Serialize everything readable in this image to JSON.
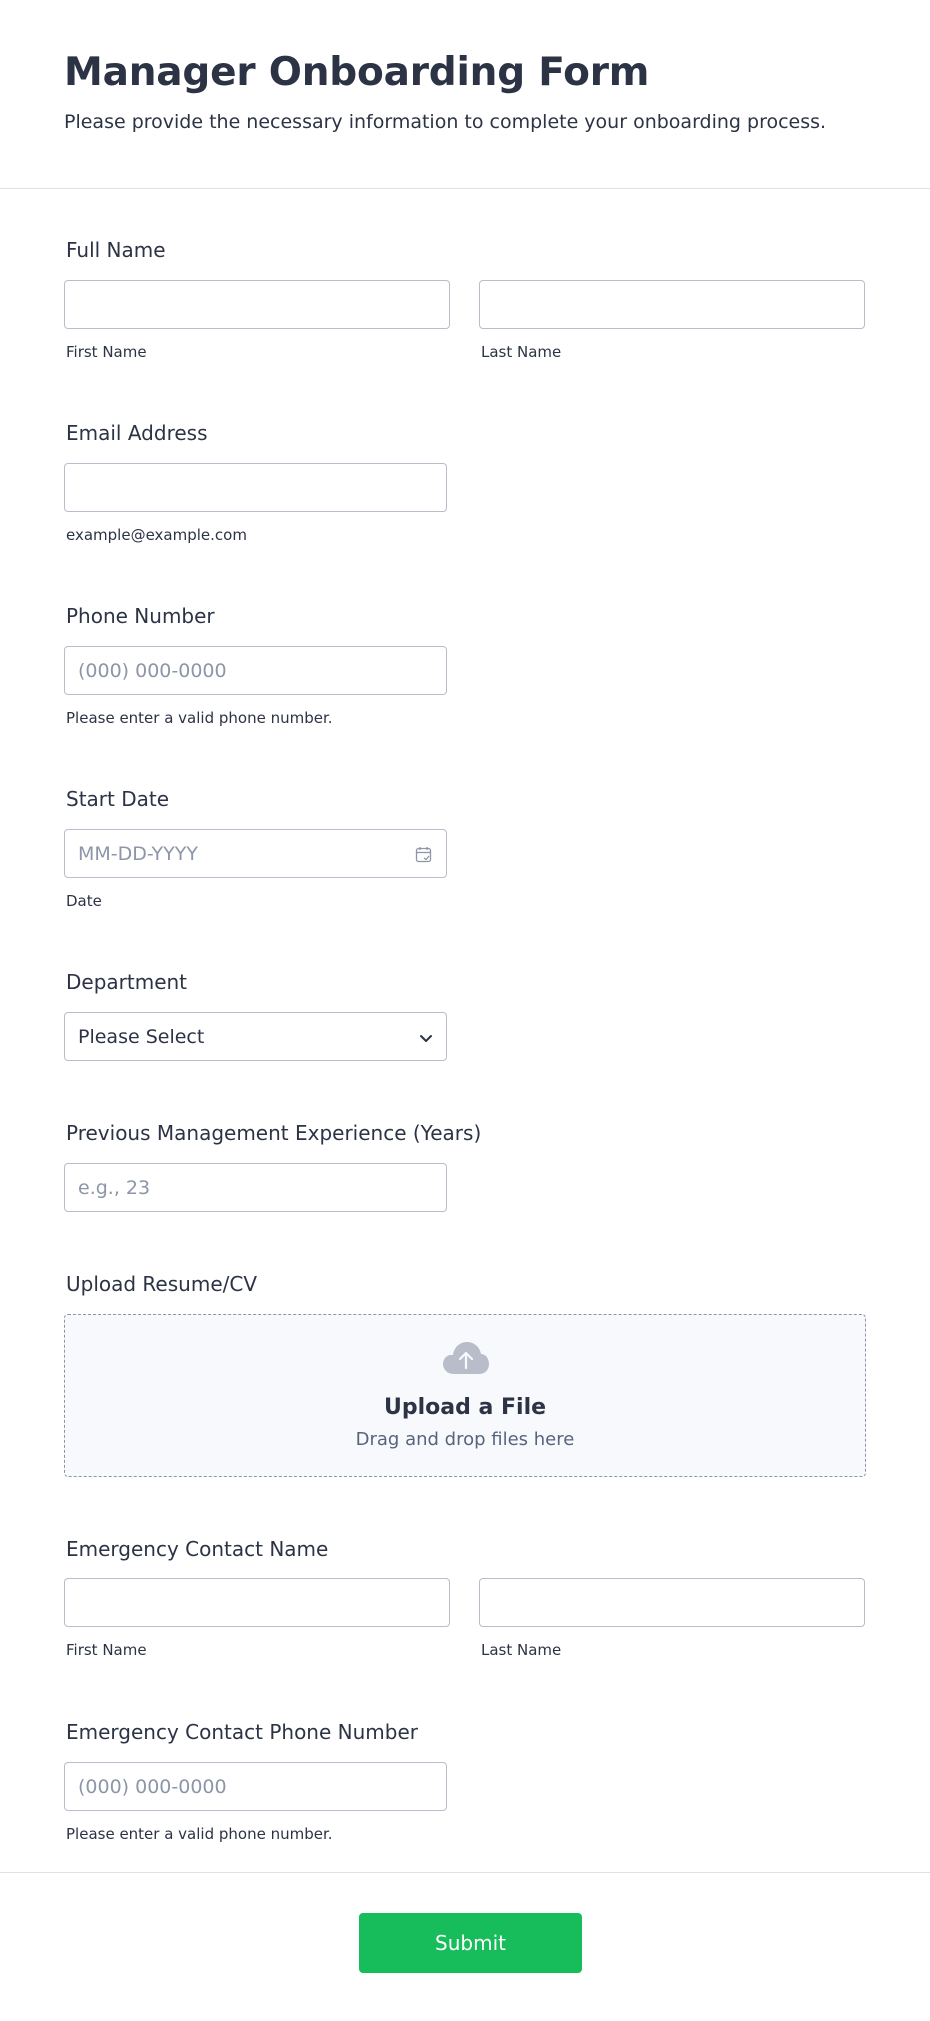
{
  "header": {
    "title": "Manager Onboarding Form",
    "subtitle": "Please provide the necessary information to complete your onboarding process."
  },
  "fields": {
    "full_name": {
      "label": "Full Name",
      "first_sublabel": "First Name",
      "last_sublabel": "Last Name",
      "first_value": "",
      "last_value": ""
    },
    "email": {
      "label": "Email Address",
      "value": "",
      "sublabel": "example@example.com"
    },
    "phone": {
      "label": "Phone Number",
      "placeholder": "(000) 000-0000",
      "sublabel": "Please enter a valid phone number."
    },
    "start_date": {
      "label": "Start Date",
      "placeholder": "MM-DD-YYYY",
      "sublabel": "Date",
      "icon": "calendar-icon"
    },
    "department": {
      "label": "Department",
      "selected": "Please Select",
      "icon": "chevron-down-icon"
    },
    "experience": {
      "label": "Previous Management Experience (Years)",
      "placeholder": "e.g., 23"
    },
    "resume": {
      "label": "Upload Resume/CV",
      "title": "Upload a File",
      "subtitle": "Drag and drop files here",
      "icon": "cloud-upload-icon"
    },
    "emergency_name": {
      "label": "Emergency Contact Name",
      "first_sublabel": "First Name",
      "last_sublabel": "Last Name",
      "first_value": "",
      "last_value": ""
    },
    "emergency_phone": {
      "label": "Emergency Contact Phone Number",
      "placeholder": "(000) 000-0000",
      "sublabel": "Please enter a valid phone number."
    }
  },
  "footer": {
    "submit_label": "Submit"
  },
  "colors": {
    "accent": "#18bd5b",
    "text": "#2c3345",
    "border": "#b8bdc9",
    "placeholder": "#8d96a8"
  }
}
